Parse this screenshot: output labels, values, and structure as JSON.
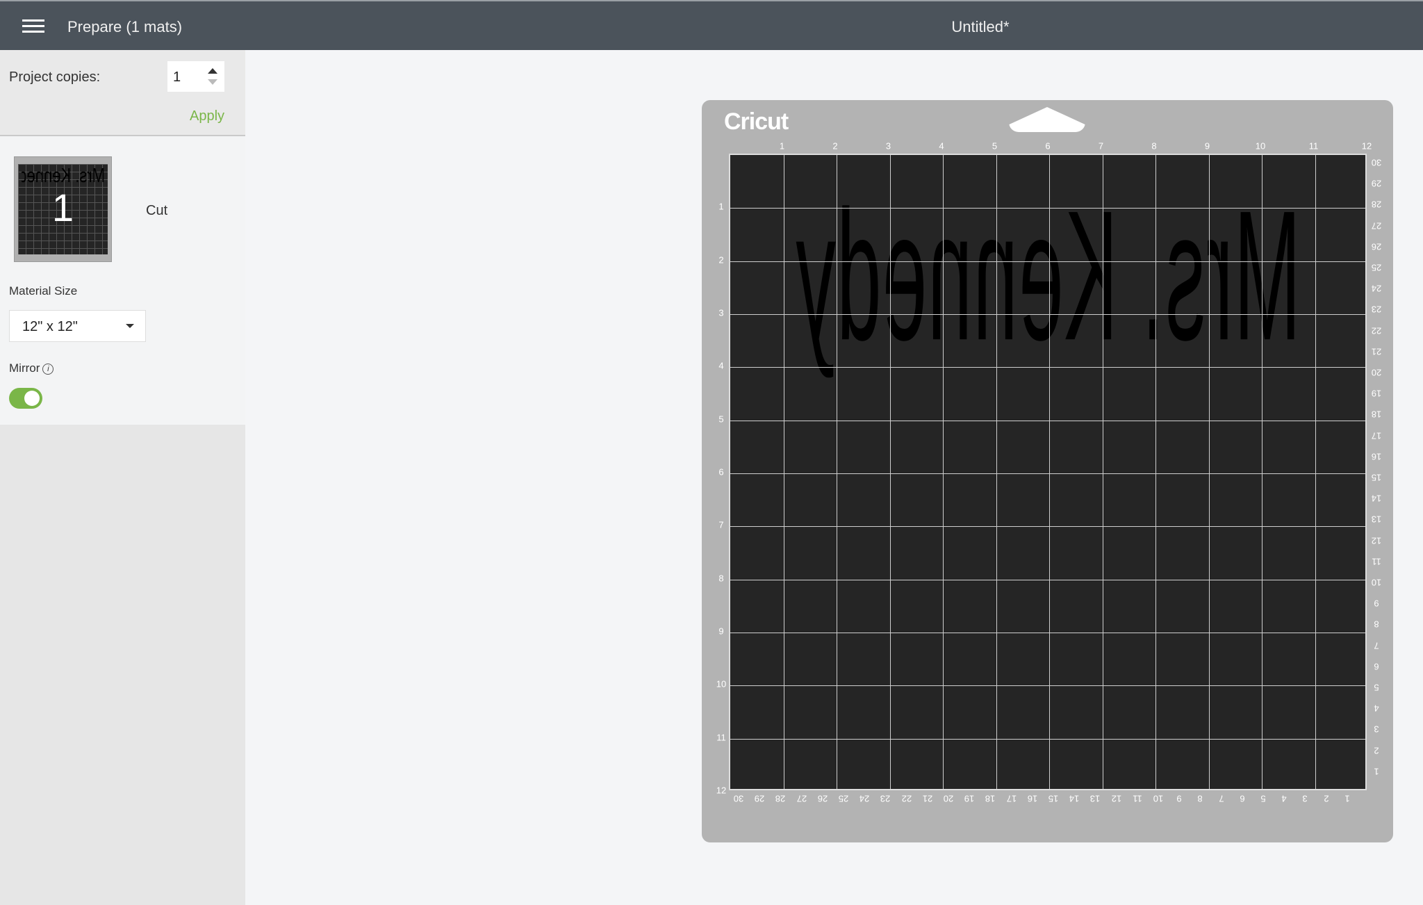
{
  "header": {
    "menu_icon": "hamburger-icon",
    "title": "Prepare (1 mats)",
    "document_title": "Untitled*"
  },
  "sidebar": {
    "copies_label": "Project copies:",
    "copies_value": "1",
    "apply_label": "Apply",
    "mat": {
      "number": "1",
      "mode": "Cut",
      "preview_text": "Mrs. Kennedy"
    },
    "material_size_label": "Material Size",
    "material_size_value": "12\" x 12\"",
    "mirror_label": "Mirror",
    "mirror_info_icon": "info-icon",
    "mirror_on": true
  },
  "mat": {
    "logo": "Cricut",
    "design_text": "Mrs. Kennedy",
    "mirrored": true,
    "top_ruler": [
      "1",
      "2",
      "3",
      "4",
      "5",
      "6",
      "7",
      "8",
      "9",
      "10",
      "11",
      "12"
    ],
    "left_ruler": [
      "1",
      "2",
      "3",
      "4",
      "5",
      "6",
      "7",
      "8",
      "9",
      "10",
      "11",
      "12"
    ],
    "right_ruler": [
      "30",
      "29",
      "28",
      "27",
      "26",
      "25",
      "24",
      "23",
      "22",
      "21",
      "20",
      "19",
      "18",
      "17",
      "16",
      "15",
      "14",
      "13",
      "12",
      "11",
      "10",
      "9",
      "8",
      "7",
      "6",
      "5",
      "4",
      "3",
      "2",
      "1"
    ],
    "bottom_ruler": [
      "30",
      "29",
      "28",
      "27",
      "26",
      "25",
      "24",
      "23",
      "22",
      "21",
      "20",
      "19",
      "18",
      "17",
      "16",
      "15",
      "14",
      "13",
      "12",
      "11",
      "10",
      "9",
      "8",
      "7",
      "6",
      "5",
      "4",
      "3",
      "2",
      "1"
    ]
  },
  "colors": {
    "accent": "#7ab648",
    "header": "#4b535b",
    "mat": "#b3b3b3",
    "grid": "#252525"
  }
}
